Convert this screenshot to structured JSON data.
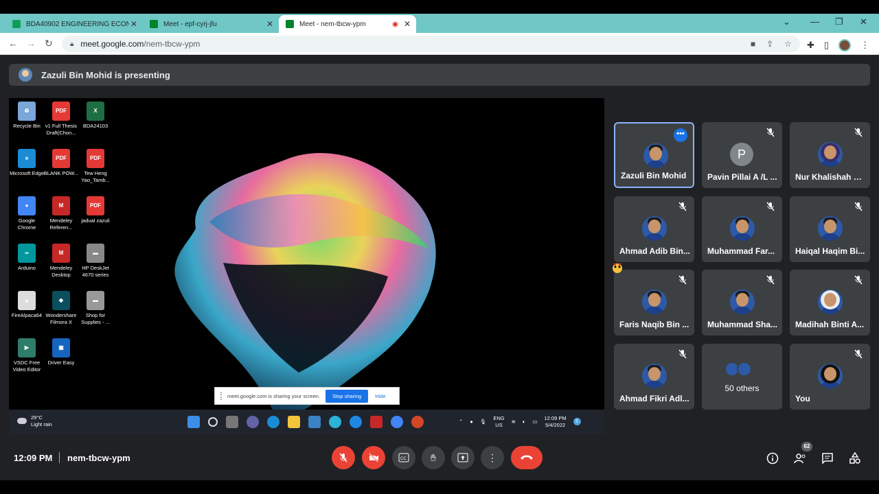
{
  "browser": {
    "tabs": [
      {
        "label": "BDA40902 ENGINEERING ECONO",
        "favicon_color": "#0f9d58"
      },
      {
        "label": "Meet - epf-cyrj-jfu",
        "favicon_color": "#00832d"
      },
      {
        "label": "Meet - nem-tbcw-ypm",
        "favicon_color": "#00832d"
      }
    ],
    "url_host": "meet.google.com",
    "url_path": "/nem-tbcw-ypm"
  },
  "presenting_banner": "Zazuli Bin Mohid is presenting",
  "desktop": {
    "icons": [
      {
        "label": "Recycle Bin",
        "icon": "recycle-bin-icon",
        "color": "#7aa6d8",
        "glyph": "♻"
      },
      {
        "label": "v1 Full Thesis Draft(Chon...",
        "icon": "pdf-icon",
        "color": "#e53935",
        "glyph": "PDF"
      },
      {
        "label": "BDA24103",
        "icon": "excel-icon",
        "color": "#1d6f42",
        "glyph": "X"
      },
      {
        "label": "Microsoft Edge",
        "icon": "edge-icon",
        "color": "#1b8bd6",
        "glyph": "e"
      },
      {
        "label": "BLANK POW...",
        "icon": "pdf-icon",
        "color": "#e53935",
        "glyph": "PDF"
      },
      {
        "label": "Tew Heng Yao_Tamb...",
        "icon": "pdf-icon",
        "color": "#e53935",
        "glyph": "PDF"
      },
      {
        "label": "Google Chrome",
        "icon": "chrome-icon",
        "color": "#4285f4",
        "glyph": "●"
      },
      {
        "label": "Mendeley Referen...",
        "icon": "mendeley-icon",
        "color": "#c62828",
        "glyph": "M"
      },
      {
        "label": "jadual zazuli",
        "icon": "pdf-icon",
        "color": "#e53935",
        "glyph": "PDF"
      },
      {
        "label": "Arduino",
        "icon": "arduino-icon",
        "color": "#00979d",
        "glyph": "∞"
      },
      {
        "label": "Mendeley Desktop",
        "icon": "mendeley-icon",
        "color": "#c62828",
        "glyph": "M"
      },
      {
        "label": "HP DeskJet 4670 series",
        "icon": "printer-icon",
        "color": "#888888",
        "glyph": "▬"
      },
      {
        "label": "FireAlpaca64",
        "icon": "firealpaca-icon",
        "color": "#dddddd",
        "glyph": "▲"
      },
      {
        "label": "Wondershare Filmora X",
        "icon": "filmora-icon",
        "color": "#0b4f5c",
        "glyph": "◆"
      },
      {
        "label": "Shop for Supplies - ...",
        "icon": "printer-icon",
        "color": "#999999",
        "glyph": "▬"
      },
      {
        "label": "VSDC Free Video Editor",
        "icon": "vsdc-icon",
        "color": "#2e7d6a",
        "glyph": "▶"
      },
      {
        "label": "Driver Easy",
        "icon": "drivereasy-icon",
        "color": "#1565c0",
        "glyph": "▣"
      }
    ],
    "share_notice": "meet.google.com is sharing your screen.",
    "stop_sharing": "Stop sharing",
    "hide": "Hide",
    "weather_temp": "29°C",
    "weather_desc": "Light rain",
    "lang_1": "ENG",
    "lang_2": "US",
    "clock_time": "12:09 PM",
    "clock_date": "5/4/2022",
    "notif_count": "5"
  },
  "participants": [
    {
      "name": "Zazuli Bin Mohid",
      "style": "male",
      "selected": true
    },
    {
      "name": "Pavin Pillai A /L ...",
      "style": "letter",
      "letter": "P"
    },
    {
      "name": "Nur Khalishah B...",
      "style": "hijab"
    },
    {
      "name": "Ahmad Adib Bin...",
      "style": "male"
    },
    {
      "name": "Muhammad Far...",
      "style": "male"
    },
    {
      "name": "Haiqal Haqim Bi...",
      "style": "male"
    },
    {
      "name": "Faris Naqib Bin ...",
      "style": "male"
    },
    {
      "name": "Muhammad Sha...",
      "style": "male"
    },
    {
      "name": "Madihah Binti A...",
      "style": "hijab-white"
    },
    {
      "name": "Ahmad Fikri Adl...",
      "style": "male"
    },
    {
      "name": "50 others",
      "style": "others"
    },
    {
      "name": "You",
      "style": "hijab-black"
    }
  ],
  "footer": {
    "time": "12:09 PM",
    "meeting_code": "nem-tbcw-ypm",
    "people_count": "62"
  }
}
